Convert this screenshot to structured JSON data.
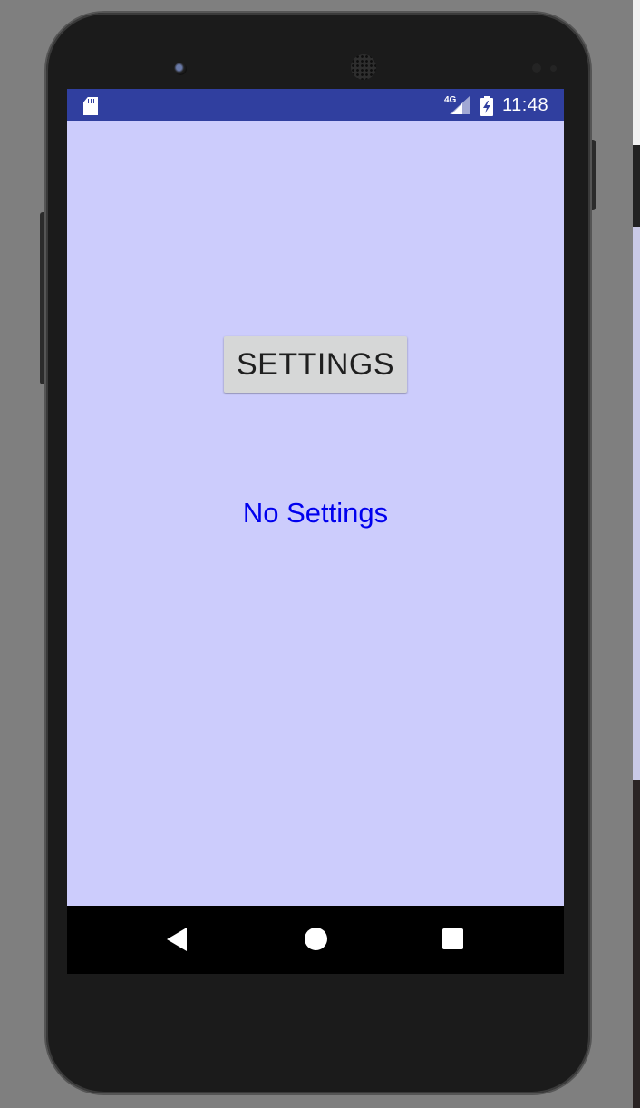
{
  "status_bar": {
    "network": "4G",
    "time": "11:48",
    "icons": [
      "sd-card-icon",
      "signal-icon",
      "battery-charging-icon"
    ]
  },
  "main": {
    "settings_button_label": "SETTINGS",
    "status_text": "No Settings"
  },
  "nav_bar": {
    "icons": [
      "back-icon",
      "home-icon",
      "recents-icon"
    ]
  },
  "colors": {
    "status_bar": "#303f9f",
    "screen_background": "#ccccfc",
    "button_background": "#d6d7d7",
    "status_text": "#0000ee",
    "nav_bar": "#000000"
  }
}
